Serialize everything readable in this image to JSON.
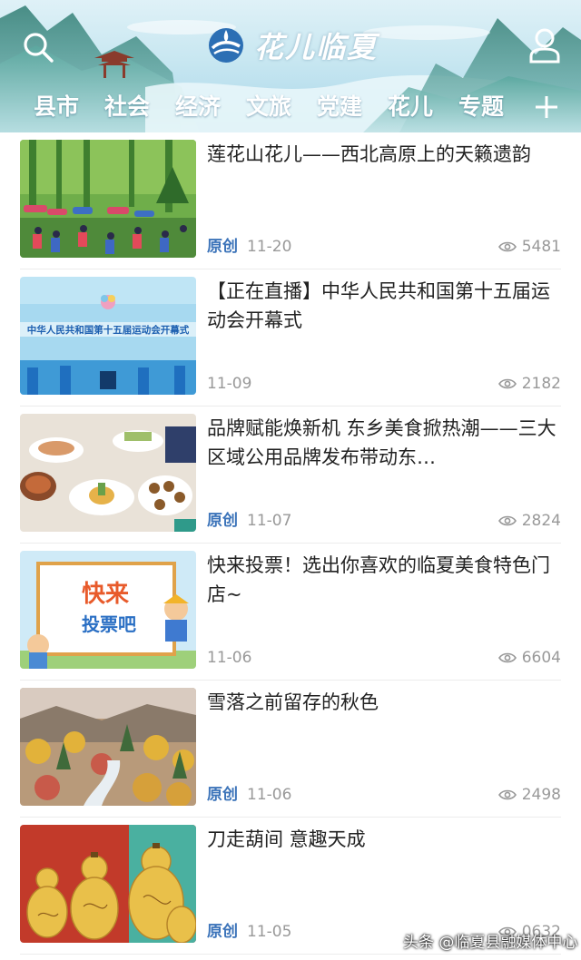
{
  "header": {
    "logo_text": "花儿临夏",
    "tabs": [
      "县市",
      "社会",
      "经济",
      "文旅",
      "党建",
      "花儿",
      "专题"
    ],
    "active_tab": "文旅",
    "colors": {
      "sky": "#c8e7f1",
      "mountain": "#3d8d83",
      "logo_blue": "#2c6fb4"
    }
  },
  "articles": [
    {
      "title": "莲花山花儿——西北高原上的天籁遗韵",
      "tag": "原创",
      "date": "11-20",
      "views": "5481",
      "thumb": "festival-crowd-image"
    },
    {
      "title": "【正在直播】中华人民共和国第十五届运动会开幕式",
      "tag": "",
      "date": "11-09",
      "views": "2182",
      "thumb": "games-opening-banner-image"
    },
    {
      "title": "品牌赋能焕新机  东乡美食掀热潮——三大区域公用品牌发布带动东…",
      "tag": "原创",
      "date": "11-07",
      "views": "2824",
      "thumb": "food-table-image"
    },
    {
      "title": "快来投票！选出你喜欢的临夏美食特色门店~",
      "tag": "",
      "date": "11-06",
      "views": "6604",
      "thumb": "vote-poster-image",
      "thumb_text": [
        "快来",
        "投票吧"
      ]
    },
    {
      "title": "雪落之前留存的秋色",
      "tag": "原创",
      "date": "11-06",
      "views": "2498",
      "thumb": "autumn-valley-image"
    },
    {
      "title": "刀走葫间  意趣天成",
      "tag": "原创",
      "date": "11-05",
      "views": "0632",
      "thumb": "carved-gourds-image"
    }
  ],
  "games_banner_text": "中华人民共和国第十五届运动会开幕式",
  "watermark": "头条 @临夏县融媒体中心"
}
